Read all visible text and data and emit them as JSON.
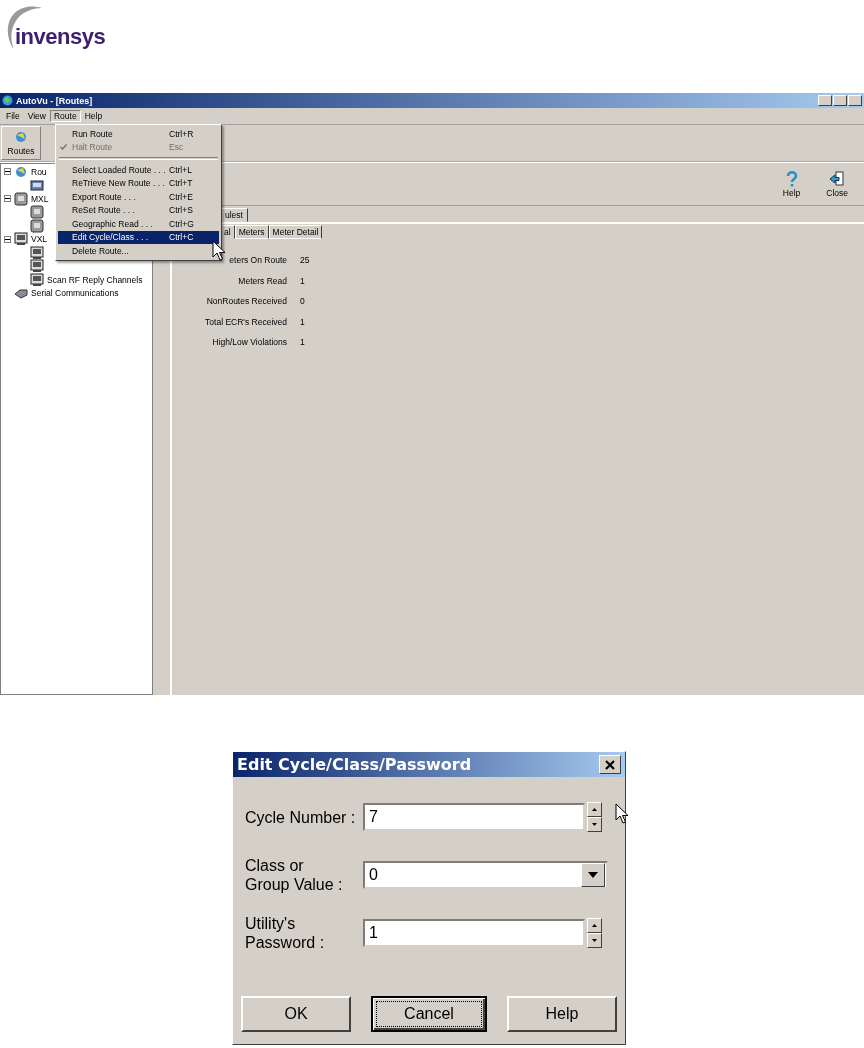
{
  "logo": {
    "text": "invensys"
  },
  "window": {
    "title": "AutoVu - [Routes]"
  },
  "menu_bar": [
    {
      "label": "File",
      "selected": false
    },
    {
      "label": "View",
      "selected": false
    },
    {
      "label": "Route",
      "selected": true
    },
    {
      "label": "Help",
      "selected": false
    }
  ],
  "toolbar": {
    "buttons": [
      {
        "label": "Routes",
        "kind": "routes"
      }
    ]
  },
  "tree": [
    {
      "label": "Rou",
      "kind": "routes",
      "expanded": true,
      "children": [
        {
          "kind": "meter"
        }
      ]
    },
    {
      "label": "MXL",
      "kind": "device",
      "expanded": true,
      "children": [
        {
          "kind": "device"
        },
        {
          "kind": "device"
        }
      ]
    },
    {
      "label": "VXL",
      "kind": "monitor",
      "expanded": true,
      "children": [
        {
          "kind": "monitor"
        },
        {
          "kind": "monitor"
        },
        {
          "label": "Scan RF Reply Channels",
          "kind": "monitor"
        }
      ]
    },
    {
      "label": "Serial Communications",
      "kind": "serial"
    }
  ],
  "route_menu": {
    "items": [
      {
        "label": "Run Route",
        "shortcut": "Ctrl+R",
        "checked": false,
        "disabled": false,
        "highlighted": false
      },
      {
        "label": "Halt Route",
        "shortcut": "Esc",
        "checked": true,
        "disabled": true,
        "highlighted": false
      },
      {
        "kind": "separator"
      },
      {
        "label": "Select Loaded Route . . .",
        "shortcut": "Ctrl+L",
        "checked": false,
        "disabled": false,
        "highlighted": false
      },
      {
        "label": "ReTrieve New Route . . .",
        "shortcut": "Ctrl+T",
        "checked": false,
        "disabled": false,
        "highlighted": false
      },
      {
        "label": "Export Route . . .",
        "shortcut": "Ctrl+E",
        "checked": false,
        "disabled": false,
        "highlighted": false
      },
      {
        "label": "ReSet Route . . .",
        "shortcut": "Ctrl+S",
        "checked": false,
        "disabled": false,
        "highlighted": false
      },
      {
        "label": "Geographic Read . . .",
        "shortcut": "Ctrl+G",
        "checked": false,
        "disabled": false,
        "highlighted": false
      },
      {
        "label": "Edit Cycle/Class . . .",
        "shortcut": "Ctrl+C",
        "checked": false,
        "disabled": false,
        "highlighted": true
      },
      {
        "label": "Delete Route...",
        "checked": false,
        "disabled": false,
        "highlighted": false
      }
    ]
  },
  "panel": {
    "buttons": [
      {
        "label": "Help",
        "kind": "help"
      },
      {
        "label": "Close",
        "kind": "close"
      }
    ],
    "tabs": [
      {
        "label": "ulest",
        "selected": true
      }
    ],
    "subtabs": [
      {
        "label": "al",
        "selected": true
      },
      {
        "label": "Meters",
        "selected": false
      },
      {
        "label": "Meter Detail",
        "selected": false
      }
    ],
    "stats": [
      {
        "label": "eters On Route",
        "value": "25"
      },
      {
        "label": "Meters Read",
        "value": "1"
      },
      {
        "label": "NonRoutes Received",
        "value": "0"
      },
      {
        "label": "Total ECR's Received",
        "value": "1"
      },
      {
        "label": "High/Low Violations",
        "value": "1"
      }
    ]
  },
  "dialog": {
    "title": "Edit Cycle/Class/Password",
    "fields": [
      {
        "label": "Cycle Number :",
        "value": "7",
        "kind": "spin"
      },
      {
        "label": "Class or\nGroup Value :",
        "value": "0",
        "kind": "dropdown"
      },
      {
        "label": "Utility's\nPassword :",
        "value": "1",
        "kind": "spin"
      }
    ],
    "buttons": [
      {
        "label": "OK",
        "focused": false
      },
      {
        "label": "Cancel",
        "focused": true
      },
      {
        "label": "Help",
        "focused": false
      }
    ]
  }
}
